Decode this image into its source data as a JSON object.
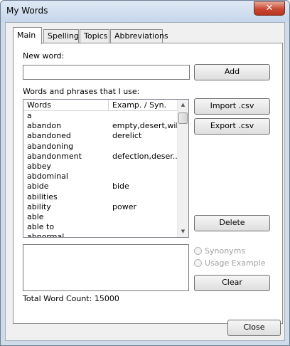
{
  "window": {
    "title": "My Words",
    "close_glyph": "✕"
  },
  "tabs": [
    {
      "label": "Main"
    },
    {
      "label": "Spelling"
    },
    {
      "label": "Topics"
    },
    {
      "label": "Abbreviations"
    }
  ],
  "main": {
    "new_word_label": "New word:",
    "new_word_value": "",
    "add_label": "Add",
    "list_label": "Words and phrases that I use:",
    "columns": [
      "Words",
      "Examp. / Syn."
    ],
    "rows": [
      {
        "word": "a",
        "ex": ""
      },
      {
        "word": "abandon",
        "ex": "empty,desert,wil..."
      },
      {
        "word": "abandoned",
        "ex": "derelict"
      },
      {
        "word": "abandoning",
        "ex": ""
      },
      {
        "word": "abandonment",
        "ex": "defection,deser..."
      },
      {
        "word": "abbey",
        "ex": ""
      },
      {
        "word": "abdominal",
        "ex": ""
      },
      {
        "word": "abide",
        "ex": "bide"
      },
      {
        "word": "abilities",
        "ex": ""
      },
      {
        "word": "ability",
        "ex": "power"
      },
      {
        "word": "able",
        "ex": ""
      },
      {
        "word": "able to",
        "ex": ""
      },
      {
        "word": "abnormal",
        "ex": ""
      }
    ],
    "import_label": "Import .csv",
    "export_label": "Export .csv",
    "delete_label": "Delete",
    "synonyms_label": "Synonyms",
    "usage_label": "Usage Example",
    "clear_label": "Clear",
    "total_label": "Total Word Count: 15000"
  },
  "footer": {
    "close_label": "Close"
  }
}
